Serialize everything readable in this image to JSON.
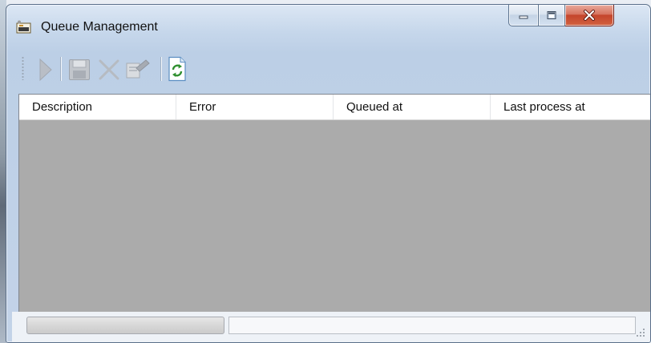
{
  "window": {
    "title": "Queue Management",
    "title_icon": "queue-app-icon",
    "caption_buttons": [
      "minimize-icon",
      "maximize-icon",
      "close-icon"
    ]
  },
  "toolbar": {
    "buttons": [
      {
        "icon": "play-icon",
        "state": "disabled"
      },
      {
        "icon": "save-icon",
        "state": "disabled"
      },
      {
        "icon": "delete-icon",
        "state": "disabled"
      },
      {
        "icon": "edit-icon",
        "state": "disabled"
      },
      {
        "icon": "refresh-icon",
        "state": "enabled"
      }
    ]
  },
  "list": {
    "columns": [
      "Description",
      "Error",
      "Queued at",
      "Last process at"
    ],
    "rows": []
  },
  "statusbar": {
    "progress": 0,
    "text": ""
  },
  "colors": {
    "list_background": "#ababab",
    "close_button": "#c4452c",
    "window_frame": "#c6d7eb"
  }
}
